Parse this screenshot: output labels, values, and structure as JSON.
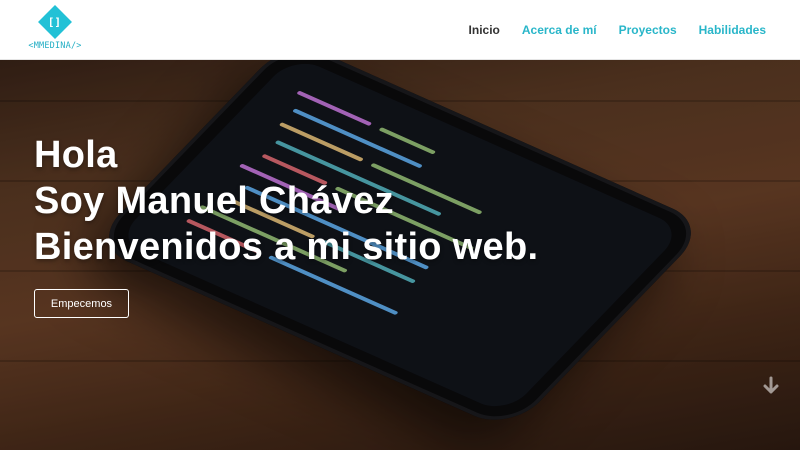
{
  "header": {
    "logo_text": "<MMEDINA/>",
    "logo_glyph": "[]",
    "nav": [
      {
        "label": "Inicio",
        "active": true
      },
      {
        "label": "Acerca de mí",
        "active": false
      },
      {
        "label": "Proyectos",
        "active": false
      },
      {
        "label": "Habilidades",
        "active": false
      }
    ]
  },
  "hero": {
    "lines": [
      "Hola",
      "Soy Manuel Chávez",
      "Bienvenidos a mi sitio web."
    ],
    "cta_label": "Empecemos",
    "scroll_icon": "arrow-down-icon"
  },
  "colors": {
    "accent": "#29b6c9",
    "nav_active": "#333333",
    "hero_text": "#ffffff"
  }
}
